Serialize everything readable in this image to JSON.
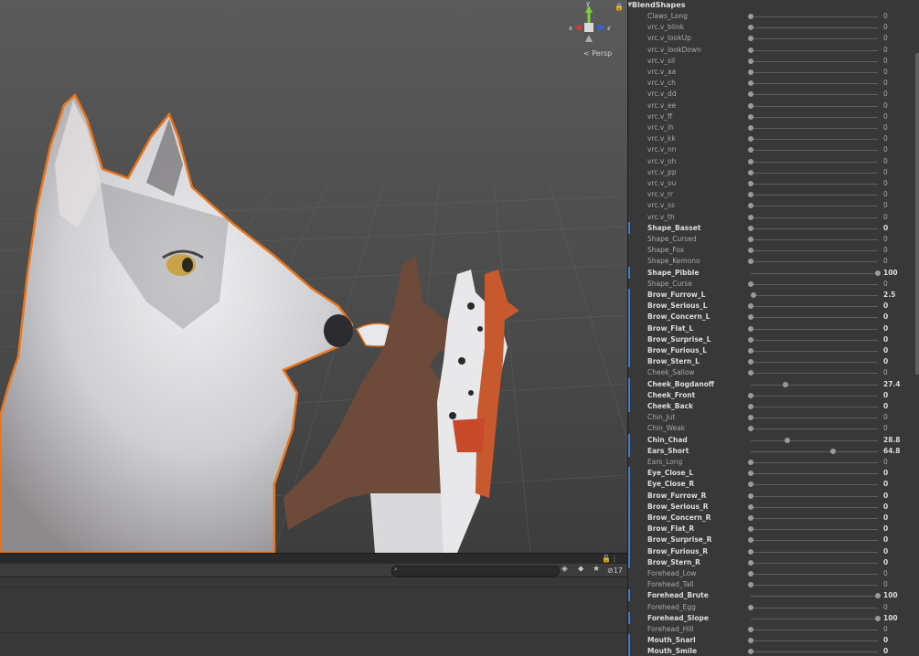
{
  "scene": {
    "persp_label": "Persp",
    "gizmo_axes": {
      "x": "x",
      "y": "y",
      "z": "z"
    }
  },
  "console": {
    "count": "17",
    "search_placeholder": ""
  },
  "blendshapes": {
    "header": "BlendShapes",
    "rows": [
      {
        "name": "Claws_Long",
        "value": "0",
        "level": 0,
        "bold": false
      },
      {
        "name": "vrc.v_blink",
        "value": "0",
        "level": 0,
        "bold": false
      },
      {
        "name": "vrc.v_lookUp",
        "value": "0",
        "level": 0,
        "bold": false
      },
      {
        "name": "vrc.v_lookDown",
        "value": "0",
        "level": 0,
        "bold": false
      },
      {
        "name": "vrc.v_sil",
        "value": "0",
        "level": 0,
        "bold": false
      },
      {
        "name": "vrc.v_aa",
        "value": "0",
        "level": 0,
        "bold": false
      },
      {
        "name": "vrc.v_ch",
        "value": "0",
        "level": 0,
        "bold": false
      },
      {
        "name": "vrc.v_dd",
        "value": "0",
        "level": 0,
        "bold": false
      },
      {
        "name": "vrc.v_ee",
        "value": "0",
        "level": 0,
        "bold": false
      },
      {
        "name": "vrc.v_ff",
        "value": "0",
        "level": 0,
        "bold": false
      },
      {
        "name": "vrc.v_ih",
        "value": "0",
        "level": 0,
        "bold": false
      },
      {
        "name": "vrc.v_kk",
        "value": "0",
        "level": 0,
        "bold": false
      },
      {
        "name": "vrc.v_nn",
        "value": "0",
        "level": 0,
        "bold": false
      },
      {
        "name": "vrc.v_oh",
        "value": "0",
        "level": 0,
        "bold": false
      },
      {
        "name": "vrc.v_pp",
        "value": "0",
        "level": 0,
        "bold": false
      },
      {
        "name": "vrc.v_ou",
        "value": "0",
        "level": 0,
        "bold": false
      },
      {
        "name": "vrc.v_rr",
        "value": "0",
        "level": 0,
        "bold": false
      },
      {
        "name": "vrc.v_ss",
        "value": "0",
        "level": 0,
        "bold": false
      },
      {
        "name": "vrc.v_th",
        "value": "0",
        "level": 0,
        "bold": false
      },
      {
        "name": "Shape_Basset",
        "value": "0",
        "level": 0,
        "bold": true
      },
      {
        "name": "Shape_Cursed",
        "value": "0",
        "level": 0,
        "bold": false
      },
      {
        "name": "Shape_Fox",
        "value": "0",
        "level": 0,
        "bold": false
      },
      {
        "name": "Shape_Kemono",
        "value": "0",
        "level": 0,
        "bold": false
      },
      {
        "name": "Shape_Pibble",
        "value": "100",
        "level": 1,
        "bold": true
      },
      {
        "name": "Shape_Curse",
        "value": "0",
        "level": 0,
        "bold": false
      },
      {
        "name": "Brow_Furrow_L",
        "value": "2.5",
        "level": 0.025,
        "bold": true
      },
      {
        "name": "Brow_Serious_L",
        "value": "0",
        "level": 0,
        "bold": true
      },
      {
        "name": "Brow_Concern_L",
        "value": "0",
        "level": 0,
        "bold": true
      },
      {
        "name": "Brow_Flat_L",
        "value": "0",
        "level": 0,
        "bold": true
      },
      {
        "name": "Brow_Surprise_L",
        "value": "0",
        "level": 0,
        "bold": true
      },
      {
        "name": "Brow_Furious_L",
        "value": "0",
        "level": 0,
        "bold": true
      },
      {
        "name": "Brow_Stern_L",
        "value": "0",
        "level": 0,
        "bold": true
      },
      {
        "name": "Cheek_Sallow",
        "value": "0",
        "level": 0,
        "bold": false
      },
      {
        "name": "Cheek_Bogdanoff",
        "value": "27.4",
        "level": 0.274,
        "bold": true
      },
      {
        "name": "Cheek_Front",
        "value": "0",
        "level": 0,
        "bold": true
      },
      {
        "name": "Cheek_Back",
        "value": "0",
        "level": 0,
        "bold": true
      },
      {
        "name": "Chin_Jut",
        "value": "0",
        "level": 0,
        "bold": false
      },
      {
        "name": "Chin_Weak",
        "value": "0",
        "level": 0,
        "bold": false
      },
      {
        "name": "Chin_Chad",
        "value": "28.8",
        "level": 0.288,
        "bold": true
      },
      {
        "name": "Ears_Short",
        "value": "64.8",
        "level": 0.648,
        "bold": true
      },
      {
        "name": "Ears_Long",
        "value": "0",
        "level": 0,
        "bold": false
      },
      {
        "name": "Eye_Close_L",
        "value": "0",
        "level": 0,
        "bold": true
      },
      {
        "name": "Eye_Close_R",
        "value": "0",
        "level": 0,
        "bold": true
      },
      {
        "name": "Brow_Furrow_R",
        "value": "0",
        "level": 0,
        "bold": true
      },
      {
        "name": "Brow_Serious_R",
        "value": "0",
        "level": 0,
        "bold": true
      },
      {
        "name": "Brow_Concern_R",
        "value": "0",
        "level": 0,
        "bold": true
      },
      {
        "name": "Brow_Flat_R",
        "value": "0",
        "level": 0,
        "bold": true
      },
      {
        "name": "Brow_Surprise_R",
        "value": "0",
        "level": 0,
        "bold": true
      },
      {
        "name": "Brow_Furious_R",
        "value": "0",
        "level": 0,
        "bold": true
      },
      {
        "name": "Brow_Stern_R",
        "value": "0",
        "level": 0,
        "bold": true
      },
      {
        "name": "Forehead_Low",
        "value": "0",
        "level": 0,
        "bold": false
      },
      {
        "name": "Forehead_Tall",
        "value": "0",
        "level": 0,
        "bold": false
      },
      {
        "name": "Forehead_Brute",
        "value": "100",
        "level": 1,
        "bold": true
      },
      {
        "name": "Forehead_Egg",
        "value": "0",
        "level": 0,
        "bold": false
      },
      {
        "name": "Forehead_Slope",
        "value": "100",
        "level": 1,
        "bold": true
      },
      {
        "name": "Forehead_Hill",
        "value": "0",
        "level": 0,
        "bold": false
      },
      {
        "name": "Mouth_Snarl",
        "value": "0",
        "level": 0,
        "bold": true
      },
      {
        "name": "Mouth_Smile",
        "value": "0",
        "level": 0,
        "bold": true
      }
    ]
  },
  "colors": {
    "selection_outline": "#e8741c",
    "modified_marker": "#3a7fd5",
    "axis_x": "#d23b3b",
    "axis_y": "#7bd23b",
    "axis_z": "#3b5fd2"
  }
}
